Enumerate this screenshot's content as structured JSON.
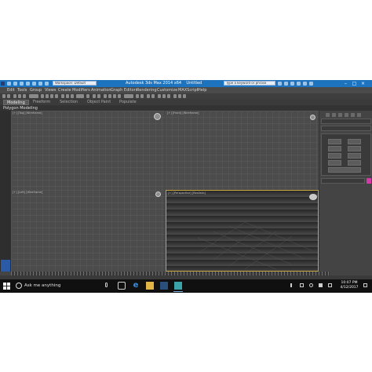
{
  "window": {
    "title": "Autodesk 3ds Max 2014 x64",
    "document": "Untitled",
    "workspace": "Workspace: Default",
    "search_placeholder": "Type a keyword or phrase"
  },
  "menu": [
    "Edit",
    "Tools",
    "Group",
    "Views",
    "Create",
    "Modifiers",
    "Animation",
    "Graph Editors",
    "Rendering",
    "Customize",
    "MAXScript",
    "Help"
  ],
  "ribbon": {
    "tabs": [
      "Modeling",
      "Freeform",
      "Selection",
      "Object Paint",
      "Populate"
    ],
    "active_tab": "Modeling",
    "panel_label": "Polygon Modeling"
  },
  "viewports": {
    "top": "[+] [Top] [Wireframe]",
    "front": "[+] [Front] [Wireframe]",
    "left": "[+] [Left] [Wireframe]",
    "perspective": "[+] [Perspective] [Realistic]"
  },
  "taskbar": {
    "search_text": "Ask me anything",
    "time": "10:07 PM",
    "date": "4/12/2017"
  },
  "colors": {
    "titlebar": "#1e73be",
    "active_viewport_border": "#c7a640",
    "object_color": "#d63aa6"
  }
}
